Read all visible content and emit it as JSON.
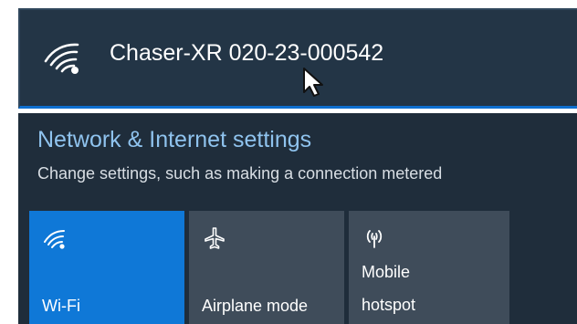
{
  "network": {
    "ssid": "Chaser-XR 020-23-000542",
    "icon": "wifi-signal-icon",
    "selected_border_color": "#0f6fcf"
  },
  "settings": {
    "title": "Network & Internet settings",
    "subtitle": "Change settings, such as making a connection metered"
  },
  "quick_actions": [
    {
      "label": "Wi-Fi",
      "icon": "wifi-icon",
      "active": true,
      "color": "#0f78d7"
    },
    {
      "label": "Airplane mode",
      "icon": "airplane-icon",
      "active": false,
      "color": "#3f4c5a"
    },
    {
      "label_line1": "Mobile",
      "label_line2": "hotspot",
      "icon": "hotspot-icon",
      "active": false,
      "color": "#3f4c5a"
    }
  ],
  "colors": {
    "panel_background": "#1f2d3b",
    "settings_link": "#8fc3ee",
    "text": "#ffffff"
  }
}
